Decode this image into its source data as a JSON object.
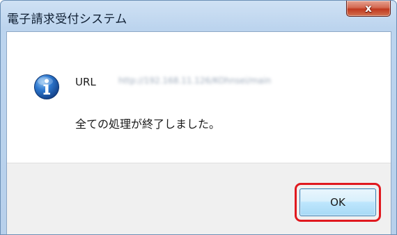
{
  "window": {
    "title": "電子請求受付システム",
    "close_glyph": "x"
  },
  "dialog": {
    "icon": "info-icon",
    "url_label": "URL",
    "url_value": "http://192.168.11.126/KOhnsei/main",
    "message": "全ての処理が終了しました。"
  },
  "buttons": {
    "ok_label": "OK"
  },
  "colors": {
    "highlight": "#e0191f",
    "info_icon": "#1f5fa8",
    "ok_border": "#3c7fb1"
  }
}
